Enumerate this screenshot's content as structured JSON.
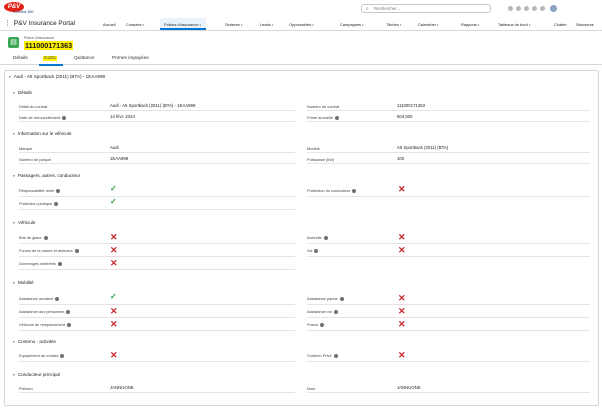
{
  "header": {
    "logo_text": "P&V",
    "logo_sub": "Connect 360",
    "search_placeholder": "Rechercher..."
  },
  "appbar": {
    "app_name": "P&V Insurance Portal",
    "nav": [
      "Accueil",
      "Comptes",
      "Polices d'assurance",
      "Sinistres",
      "Leads",
      "Opportunités",
      "Campagnes",
      "Tâches",
      "Calendrier",
      "Rapports",
      "Tableaux de bord",
      "Chatter",
      "Structures"
    ]
  },
  "record": {
    "type_label": "Police d'assurance",
    "number": "111000171363"
  },
  "tabs": [
    "Détails",
    "CoZo",
    "Quittance",
    "Primes impayées"
  ],
  "panel": {
    "title": "Audi - A5 Sportback (2011) (BTA) - 1EAA999",
    "sections": {
      "details": {
        "title": "Détails",
        "detail_contrat_label": "Détail du contrat",
        "detail_contrat_value": "Audi - A5 Sportback (2011) (BTA) - 1EAA999",
        "numero_contrat_label": "Numéro de contrat",
        "numero_contrat_value": "111000171363",
        "date_renouv_label": "Date de renouvellement",
        "date_renouv_value": "14 févr. 2024",
        "prime_label": "Prime annuelle",
        "prime_value": "504,925"
      },
      "vehicule": {
        "title": "Information sur le véhicule",
        "marque_label": "Marque",
        "marque_value": "Audi",
        "modele_label": "Modèle",
        "modele_value": "A5 Sportback (2011) (BTA)",
        "plaque_label": "Numéro de plaque",
        "plaque_value": "1EAA999",
        "puissance_label": "Puissance (kW)",
        "puissance_value": "100"
      },
      "passagers": {
        "title": "Passagers, autres, conducteur",
        "resp_civile": "Responsabilité civile",
        "prot_conducteur": "Protection du conducteur",
        "prot_juridique": "Protection juridique"
      },
      "vehicule2": {
        "title": "Véhicule",
        "bris_glace": "Bris de glace",
        "incendie": "Incendie",
        "forces_nature": "Forces de la nature et animaux",
        "vol": "Vol",
        "dommages": "Dommages matériels"
      },
      "mobilite": {
        "title": "Mobilité",
        "assist_accident": "Assistance accident",
        "assist_panne": "Assistance panne",
        "assist_personnes": "Assistance aux personnes",
        "assist_vol": "Assistance vol",
        "vehicule_rempl": "Véhicule de remplacement",
        "pneus": "Pneus"
      },
      "contenu": {
        "title": "Contenu - activités",
        "equipement": "Equipement du motard",
        "contenu_prive": "Contenu Privé"
      },
      "conducteur": {
        "title": "Conducteur principal",
        "prenom_label": "Prénom",
        "prenom_value": "JANNUONE",
        "nom_label": "Nom",
        "nom_value": "JANNUONE"
      }
    }
  },
  "colors": {
    "accent": "#0176d3",
    "check": "#2e9e44",
    "cross": "#c8262d",
    "highlight": "#fff200"
  }
}
